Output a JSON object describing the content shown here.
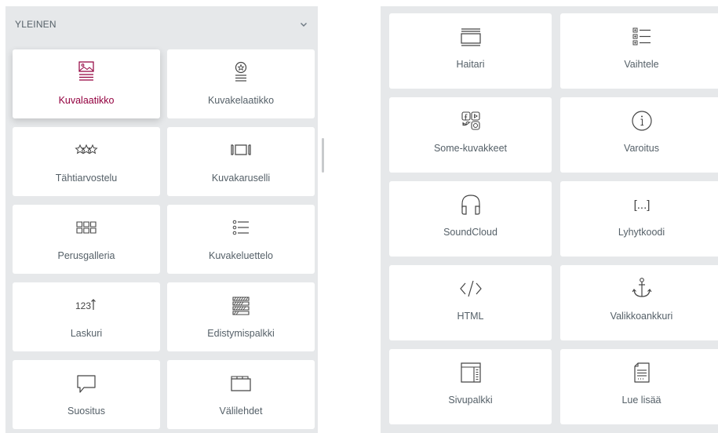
{
  "left": {
    "section_title": "YLEINEN",
    "widgets": [
      {
        "label": "Kuvalaatikko",
        "icon": "image-box-icon",
        "active": true
      },
      {
        "label": "Kuvakelaatikko",
        "icon": "icon-box-icon"
      },
      {
        "label": "Tähtiarvostelu",
        "icon": "star-rating-icon"
      },
      {
        "label": "Kuvakaruselli",
        "icon": "image-carousel-icon"
      },
      {
        "label": "Perusgalleria",
        "icon": "basic-gallery-icon"
      },
      {
        "label": "Kuvakeluettelo",
        "icon": "icon-list-icon"
      },
      {
        "label": "Laskuri",
        "icon": "counter-icon",
        "icon_text": "123"
      },
      {
        "label": "Edistymispalkki",
        "icon": "progress-bar-icon"
      },
      {
        "label": "Suositus",
        "icon": "testimonial-icon"
      },
      {
        "label": "Välilehdet",
        "icon": "tabs-icon"
      }
    ]
  },
  "right": {
    "widgets": [
      {
        "label": "Haitari",
        "icon": "accordion-icon"
      },
      {
        "label": "Vaihtele",
        "icon": "toggle-icon"
      },
      {
        "label": "Some-kuvakkeet",
        "icon": "social-icons-icon"
      },
      {
        "label": "Varoitus",
        "icon": "alert-icon"
      },
      {
        "label": "SoundCloud",
        "icon": "soundcloud-icon"
      },
      {
        "label": "Lyhytkoodi",
        "icon": "shortcode-icon",
        "icon_text": "[...]"
      },
      {
        "label": "HTML",
        "icon": "html-icon"
      },
      {
        "label": "Valikkoankkuri",
        "icon": "menu-anchor-icon"
      },
      {
        "label": "Sivupalkki",
        "icon": "sidebar-icon"
      },
      {
        "label": "Lue lisää",
        "icon": "read-more-icon"
      }
    ]
  },
  "colors": {
    "active_accent": "#93003f",
    "panel_bg": "#e6e8ea",
    "card_bg": "#ffffff"
  }
}
